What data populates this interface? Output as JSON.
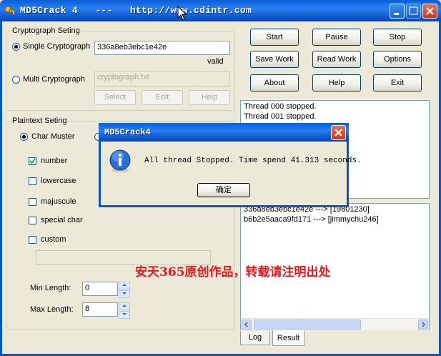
{
  "window": {
    "title": "MD5Crack 4   ---   http://www.cdintr.com"
  },
  "crypto": {
    "group_label": "Cryptograph Seting",
    "single_label": "Single Cryptograph",
    "single_value": "336a8eb3ebc1e42e",
    "valid_label": "valid",
    "multi_label": "Multi Cryptograph",
    "multi_placeholder": "cryptograph.txt",
    "select_label": "Select",
    "edit_label": "Edit",
    "help_label": "Help"
  },
  "plaintext": {
    "group_label": "Plaintext Seting",
    "char_muster_label": "Char Muster",
    "options": [
      {
        "label": "number",
        "checked": true
      },
      {
        "label": "lowercase",
        "checked": false
      },
      {
        "label": "majuscule",
        "checked": false
      },
      {
        "label": "special char",
        "checked": false
      },
      {
        "label": "custom",
        "checked": false
      }
    ],
    "min_length_label": "Min Length:",
    "min_length_value": "0",
    "max_length_label": "Max Length:",
    "max_length_value": "8"
  },
  "actions": {
    "start": "Start",
    "pause": "Pause",
    "stop": "Stop",
    "save_work": "Save Work",
    "read_work": "Read Work",
    "options": "Options",
    "about": "About",
    "help": "Help",
    "exit": "Exit"
  },
  "log": {
    "lines": [
      "Thread 000 stopped.",
      "Thread 001 stopped."
    ]
  },
  "results": {
    "lines": [
      "336a8eb3ebc1e42e  ---> [19801230]",
      "b6b2e5aaca9fd171  ---> [jimmychu246]"
    ]
  },
  "tabs": {
    "log": "Log",
    "result": "Result"
  },
  "dialog": {
    "title": "MD5Crack4",
    "message": "All thread Stopped. Time spend 41.313 seconds.",
    "ok_label": "确定",
    "icon": "info-icon"
  },
  "watermark": "安天365原创作品，转载请注明出处",
  "colors": {
    "titlebar": "#0b53c9",
    "watermark": "#e8161b",
    "window_bg": "#ece9d8"
  }
}
